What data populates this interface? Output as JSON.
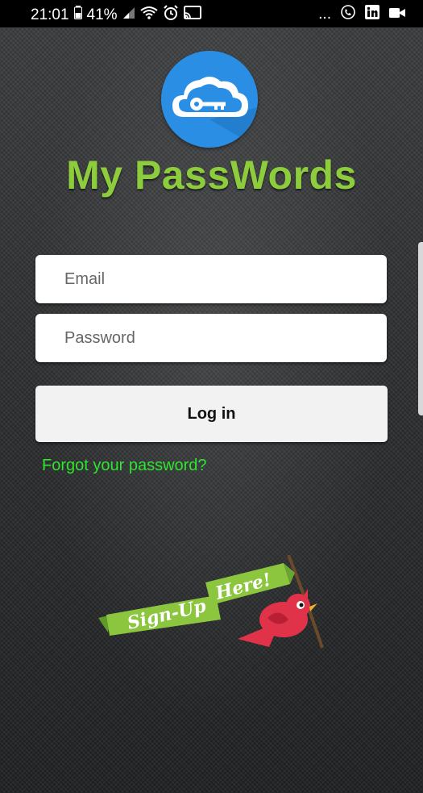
{
  "status_bar": {
    "time": "21:01",
    "battery": "41%",
    "more": "..."
  },
  "app": {
    "title": "My PassWords"
  },
  "form": {
    "email_placeholder": "Email",
    "password_placeholder": "Password",
    "login_label": "Log in",
    "forgot_label": "Forgot your password?"
  },
  "signup": {
    "banner_text": "Sign-Up",
    "here_text": "Here!"
  },
  "colors": {
    "title_green": "#8dcc3c",
    "link_green": "#2ee62e",
    "logo_blue": "#2a8fe4",
    "banner_green": "#8cc63f",
    "bird_red": "#e0334a"
  }
}
